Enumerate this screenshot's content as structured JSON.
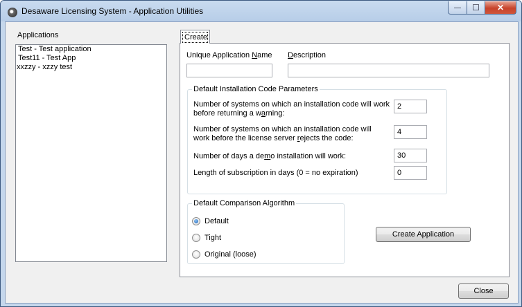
{
  "window": {
    "title": "Desaware Licensing System - Application Utilities",
    "min_glyph": "—",
    "max_glyph": "☐",
    "close_glyph": "✕"
  },
  "applications": {
    "label": "Applications",
    "items": [
      "Test - Test application",
      "Test11 - Test App",
      "xxzzy - xzzy test"
    ]
  },
  "tabs": [
    {
      "label": "Create",
      "selected": true
    }
  ],
  "create": {
    "unique_name_label_pre": "Unique Application ",
    "unique_name_label_key": "N",
    "unique_name_label_post": "ame",
    "unique_name_value": "",
    "description_label_key": "D",
    "description_label_post": "escription",
    "description_value": "",
    "install_group": {
      "title": "Default Installation Code Parameters",
      "warn_line1": "Number of systems on which an installation code will work",
      "warn_line2_pre": "before returning a w",
      "warn_line2_key": "a",
      "warn_line2_post": "rning:",
      "warn_value": "2",
      "reject_line1": "Number of systems on which an installation code will",
      "reject_line2_pre": "work before the license server ",
      "reject_line2_key": "r",
      "reject_line2_post": "ejects the code:",
      "reject_value": "4",
      "demo_pre": "Number of days a de",
      "demo_key": "m",
      "demo_post": "o installation will work:",
      "demo_value": "30",
      "subscription_label": "Length of subscription in days (0 = no expiration)",
      "subscription_value": "0"
    },
    "algorithm_group": {
      "title": "Default Comparison Algorithm",
      "options": [
        {
          "label": "Default",
          "checked": true
        },
        {
          "label": "Tight",
          "checked": false
        },
        {
          "label": "Original (loose)",
          "checked": false
        }
      ]
    },
    "create_button": "Create Application"
  },
  "close_button": "Close"
}
